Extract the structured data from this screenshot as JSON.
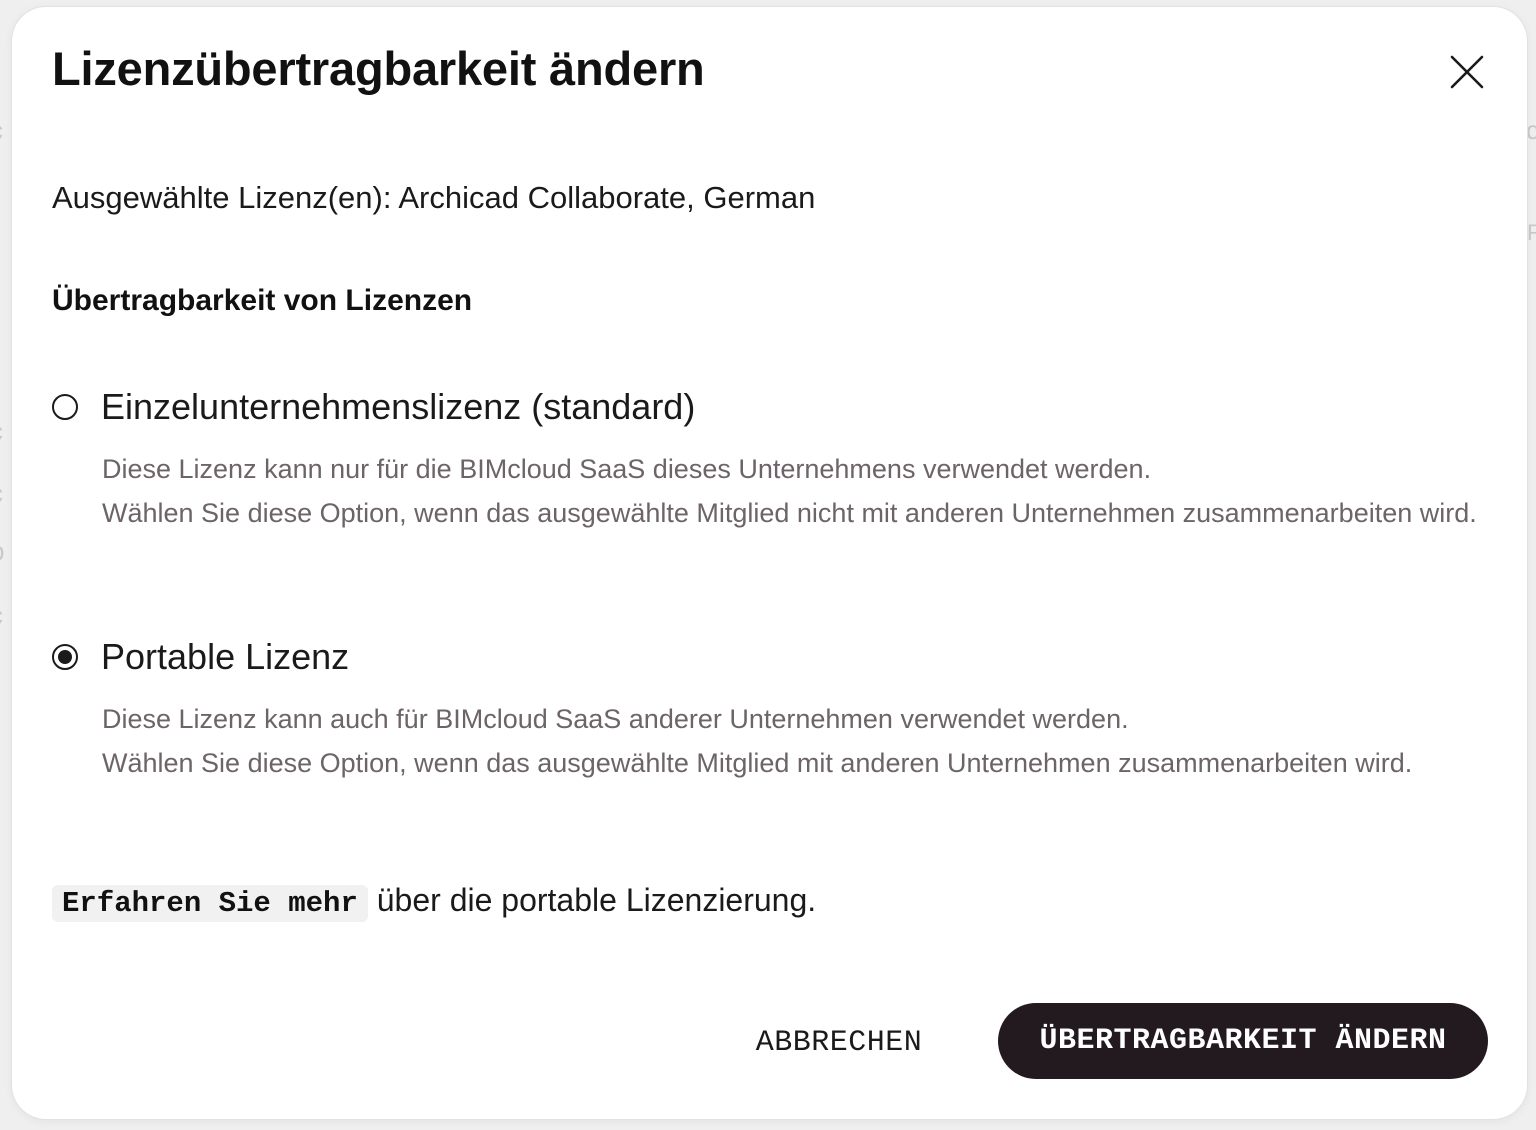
{
  "dialog": {
    "title": "Lizenzübertragbarkeit ändern",
    "close_icon": "close-icon",
    "selected_licenses": "Ausgewählte Lizenz(en): Archicad Collaborate, German",
    "section_heading": "Übertragbarkeit von Lizenzen",
    "options": [
      {
        "label": "Einzelunternehmenslizenz (standard)",
        "checked": false,
        "desc_line1": "Diese Lizenz kann nur für die BIMcloud SaaS dieses Unternehmens verwendet werden.",
        "desc_line2": "Wählen Sie diese Option, wenn das ausgewählte Mitglied nicht mit anderen Unternehmen zusammenarbeiten wird."
      },
      {
        "label": "Portable Lizenz",
        "checked": true,
        "desc_line1": "Diese Lizenz kann auch für BIMcloud SaaS anderer Unternehmen verwendet werden.",
        "desc_line2": "Wählen Sie diese Option, wenn das ausgewählte Mitglied mit anderen Unternehmen zusammenarbeiten wird."
      }
    ],
    "learn_more_link": "Erfahren Sie mehr",
    "learn_more_suffix": " über die portable Lizenzierung.",
    "cancel_label": "ABBRECHEN",
    "confirm_label": "ÜBERTRAGBARKEIT ÄNDERN"
  },
  "colors": {
    "primary_button": "#221a1f",
    "description_text": "#6c6468"
  }
}
